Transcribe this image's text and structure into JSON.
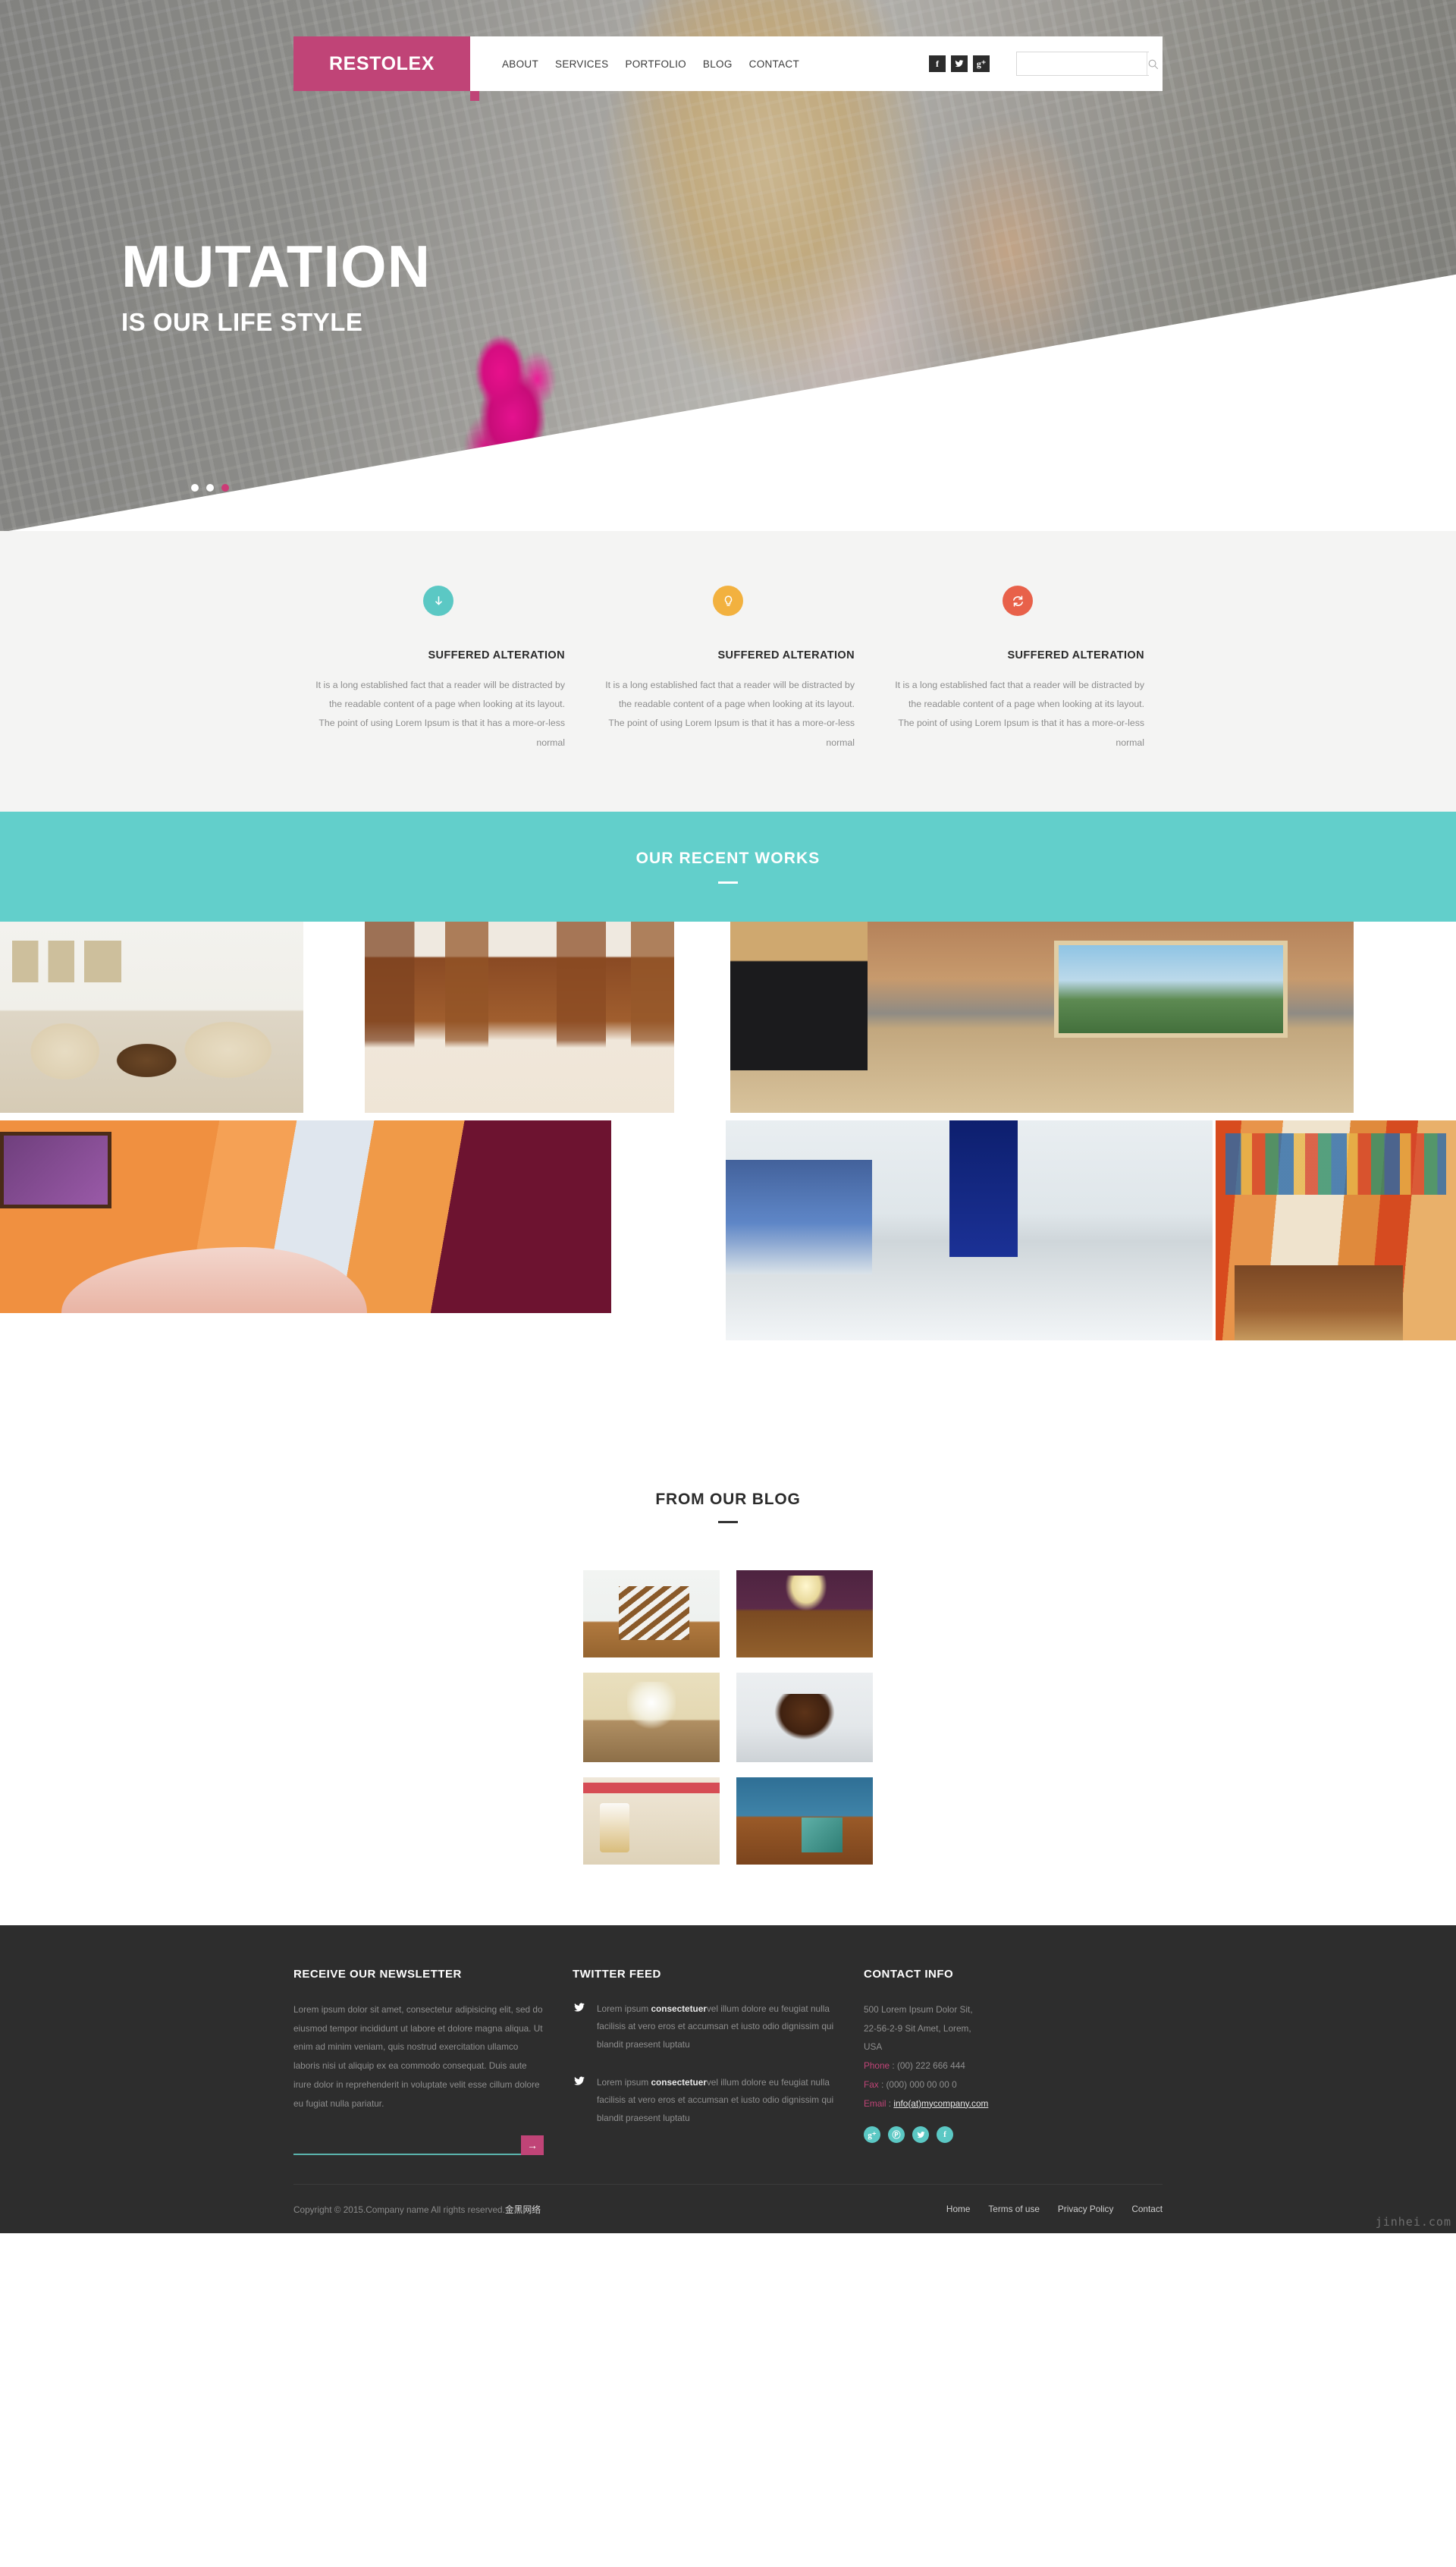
{
  "header": {
    "logo": "RESTOLEX",
    "nav": [
      {
        "label": "ABOUT"
      },
      {
        "label": "SERVICES"
      },
      {
        "label": "PORTFOLIO"
      },
      {
        "label": "BLOG"
      },
      {
        "label": "CONTACT"
      }
    ],
    "socials": [
      {
        "name": "facebook-icon",
        "glyph": "f"
      },
      {
        "name": "twitter-icon",
        "glyph": "ᵛ"
      },
      {
        "name": "google-plus-icon",
        "glyph": "g⁺"
      }
    ],
    "search": {
      "value": "",
      "placeholder": ""
    },
    "brand_color": "#c04477"
  },
  "hero": {
    "title": "MUTATION",
    "subtitle": "IS OUR LIFE STYLE",
    "slides": [
      {
        "active": false
      },
      {
        "active": false
      },
      {
        "active": true
      }
    ],
    "active_dot_color": "#cc3a76"
  },
  "features": {
    "background": "#f4f4f3",
    "items": [
      {
        "icon": "download-arrow-icon",
        "glyph": "↓",
        "color": "#5bc8c4",
        "title": "SUFFERED ALTERATION",
        "text": "It is a long established fact that a reader will be distracted by the readable content of a page when looking at its layout. The point of using Lorem Ipsum is that it has a more-or-less normal"
      },
      {
        "icon": "lightbulb-icon",
        "glyph": "●",
        "color": "#f2b13f",
        "title": "SUFFERED ALTERATION",
        "text": "It is a long established fact that a reader will be distracted by the readable content of a page when looking at its layout. The point of using Lorem Ipsum is that it has a more-or-less normal"
      },
      {
        "icon": "refresh-icon",
        "glyph": "↻",
        "color": "#e8614a",
        "title": "SUFFERED ALTERATION",
        "text": "It is a long established fact that a reader will be distracted by the readable content of a page when looking at its layout. The point of using Lorem Ipsum is that it has a more-or-less normal"
      }
    ]
  },
  "works": {
    "heading": "OUR RECENT WORKS",
    "banner_color": "#62cfcb",
    "tiles": [
      {
        "name": "portfolio-tile-living-room"
      },
      {
        "name": "portfolio-tile-wood-kitchen"
      },
      {
        "name": "portfolio-tile-bright-kitchen"
      },
      {
        "name": "portfolio-tile-orange-room"
      },
      {
        "name": "portfolio-tile-office-lobby"
      },
      {
        "name": "portfolio-tile-temple-interior"
      }
    ]
  },
  "blog": {
    "heading": "FROM OUR BLOG",
    "posts": [
      {
        "name": "blog-thumb-stairs"
      },
      {
        "name": "blog-thumb-ballroom"
      },
      {
        "name": "blog-thumb-chandelier"
      },
      {
        "name": "blog-thumb-tea-cup"
      },
      {
        "name": "blog-thumb-table-setting"
      },
      {
        "name": "blog-thumb-furniture"
      }
    ]
  },
  "footer": {
    "newsletter": {
      "heading": "RECEIVE OUR NEWSLETTER",
      "text": "Lorem ipsum dolor sit amet, consectetur adipisicing elit, sed do eiusmod tempor incididunt ut labore et dolore magna aliqua. Ut enim ad minim veniam, quis nostrud exercitation ullamco laboris nisi ut aliquip ex ea commodo consequat. Duis aute irure dolor in reprehenderit in voluptate velit esse cillum dolore eu fugiat nulla pariatur.",
      "input_value": "",
      "input_placeholder": "",
      "submit_glyph": "→",
      "submit_color": "#c04477",
      "underline_color": "#5bb5ad"
    },
    "twitter": {
      "heading": "TWITTER FEED",
      "tweets": [
        {
          "prefix": "Lorem ipsum ",
          "highlight": "consectetuer",
          "rest": "vel illum dolore eu feugiat nulla facilisis at vero eros et accumsan et iusto odio dignissim qui blandit praesent luptatu"
        },
        {
          "prefix": "Lorem ipsum ",
          "highlight": "consectetuer",
          "rest": "vel illum dolore eu feugiat nulla facilisis at vero eros et accumsan et iusto odio dignissim qui blandit praesent luptatu"
        }
      ]
    },
    "contact": {
      "heading": "CONTACT INFO",
      "address_line1": "500 Lorem Ipsum Dolor Sit,",
      "address_line2": "22-56-2-9 Sit Amet, Lorem,",
      "address_line3": "USA",
      "phone_label": "Phone",
      "phone_value": ": (00) 222 666 444",
      "fax_label": "Fax",
      "fax_value": ": (000) 000 00 00 0",
      "email_label": "Email",
      "email_sep": " : ",
      "email_value": "info(at)mycompany.com",
      "label_color": "#c04477",
      "socials": [
        {
          "name": "google-plus-icon",
          "glyph": "g⁺"
        },
        {
          "name": "pinterest-icon",
          "glyph": "Ⓟ"
        },
        {
          "name": "twitter-icon",
          "glyph": "ᵛ"
        },
        {
          "name": "facebook-icon",
          "glyph": "f"
        }
      ],
      "social_color": "#5bc8c4"
    },
    "bottom": {
      "copyright": "Copyright © 2015.Company name All rights reserved.",
      "copyright_cn": "金黑网络",
      "links": [
        {
          "label": "Home"
        },
        {
          "label": "Terms of use"
        },
        {
          "label": "Privacy Policy"
        },
        {
          "label": "Contact"
        }
      ]
    }
  },
  "watermark": "jinhei.com"
}
